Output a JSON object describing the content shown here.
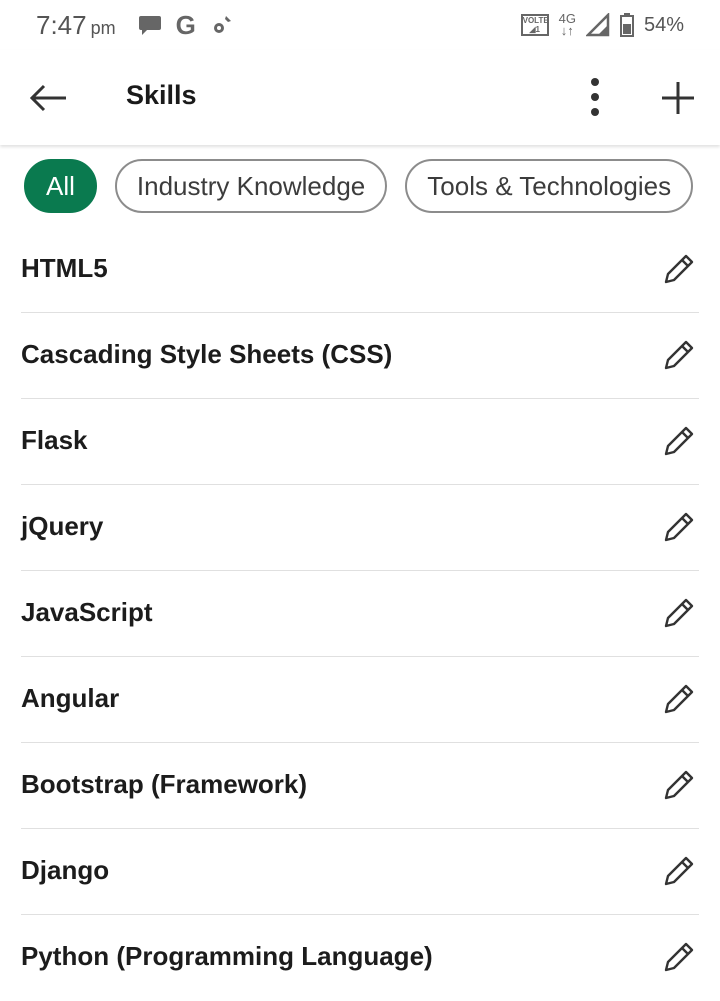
{
  "status_bar": {
    "time": "7:47",
    "ampm": "pm",
    "volte": "VOLTE",
    "network": "4G",
    "battery": "54%"
  },
  "app_bar": {
    "title": "Skills",
    "back_icon": "arrow-left-icon",
    "more_icon": "more-vert-icon",
    "add_icon": "plus-icon"
  },
  "filters": [
    {
      "label": "All",
      "active": true
    },
    {
      "label": "Industry Knowledge",
      "active": false
    },
    {
      "label": "Tools & Technologies",
      "active": false
    }
  ],
  "skills": [
    {
      "name": "HTML5"
    },
    {
      "name": "Cascading Style Sheets (CSS)"
    },
    {
      "name": "Flask"
    },
    {
      "name": "jQuery"
    },
    {
      "name": "JavaScript"
    },
    {
      "name": "Angular"
    },
    {
      "name": "Bootstrap (Framework)"
    },
    {
      "name": "Django"
    },
    {
      "name": "Python (Programming Language)"
    }
  ],
  "colors": {
    "accent": "#0a7a4f",
    "text": "#1a1a1a",
    "divider": "#e0e0e0"
  }
}
